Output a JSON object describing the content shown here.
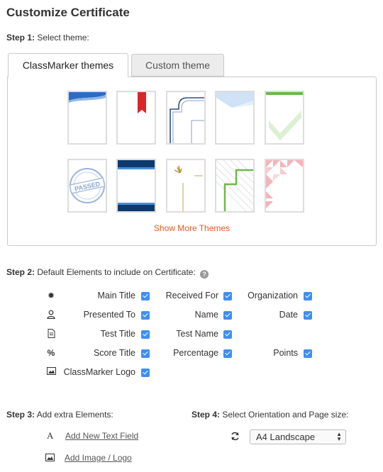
{
  "title": "Customize Certificate",
  "step1": {
    "prefix": "Step 1:",
    "text": "Select theme:"
  },
  "tabs": [
    {
      "label": "ClassMarker themes",
      "active": true
    },
    {
      "label": "Custom theme",
      "active": false
    }
  ],
  "themes": {
    "stamp_text": "PASSED",
    "show_more": "Show More Themes"
  },
  "step2": {
    "prefix": "Step 2:",
    "text": "Default Elements to include on Certificate:",
    "help": "?"
  },
  "elements": {
    "main_title": "Main Title",
    "received_for": "Received For",
    "organization": "Organization",
    "presented_to": "Presented To",
    "name": "Name",
    "date": "Date",
    "test_title": "Test Title",
    "test_name": "Test Name",
    "score_title": "Score Title",
    "percentage": "Percentage",
    "points": "Points",
    "classmarker_logo": "ClassMarker Logo"
  },
  "step3": {
    "prefix": "Step 3:",
    "text": "Add extra Elements:"
  },
  "extra": {
    "add_text": "Add New Text Field",
    "add_image": "Add Image / Logo",
    "text_glyph": "A"
  },
  "step4": {
    "prefix": "Step 4:",
    "text": "Select Orientation and Page size:"
  },
  "page_size": {
    "selected": "A4 Landscape"
  },
  "colors": {
    "accent": "#3e8ef7",
    "link_orange": "#e85a1d"
  }
}
